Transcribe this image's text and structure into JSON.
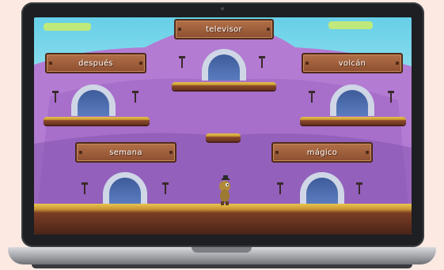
{
  "words": [
    "televisor",
    "después",
    "volcán",
    "semana",
    "mágico"
  ],
  "colors": {
    "sky_top": "#66cfe8",
    "mountain": "#b37bd2",
    "sign_wood": "#8c4f30",
    "platform_grass": "#e5c04f",
    "ground_dirt": "#4a2417"
  }
}
